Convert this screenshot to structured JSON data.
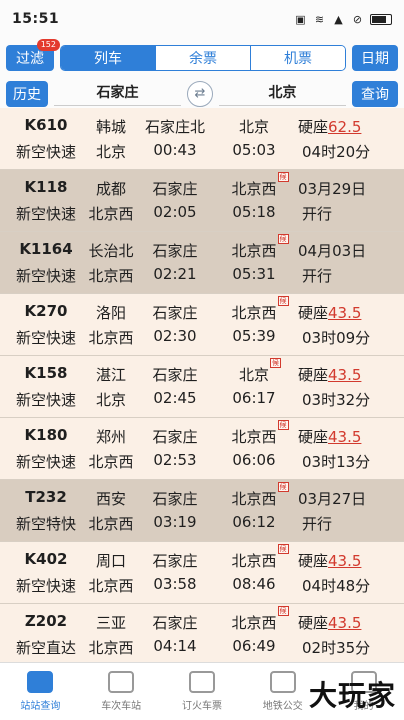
{
  "status_bar": {
    "time": "15:51"
  },
  "top": {
    "filter_label": "过滤",
    "filter_badge": "152",
    "tabs": [
      {
        "label": "列车",
        "active": true
      },
      {
        "label": "余票",
        "active": false
      },
      {
        "label": "机票",
        "active": false
      }
    ],
    "date_label": "日期"
  },
  "search": {
    "history_label": "历史",
    "from": "石家庄",
    "to": "北京",
    "swap_icon": "swap-icon",
    "query_label": "查询"
  },
  "trains": [
    {
      "code": "K610",
      "type": "新空快速",
      "origin": "韩城",
      "dest": "北京",
      "from": "石家庄北",
      "to": "北京",
      "to_fu": false,
      "dep": "00:43",
      "arr": "05:03",
      "seat": "硬座",
      "price": "62.5",
      "duration": "04时20分",
      "status": "",
      "shade": "light"
    },
    {
      "code": "K118",
      "type": "新空快速",
      "origin": "成都",
      "dest": "北京西",
      "from": "石家庄",
      "to": "北京西",
      "to_fu": true,
      "dep": "02:05",
      "arr": "05:18",
      "seat": "",
      "price": "",
      "duration": "",
      "status_date": "03月29日",
      "status": "开行",
      "shade": "dark"
    },
    {
      "code": "K1164",
      "type": "新空快速",
      "origin": "长治北",
      "dest": "北京西",
      "from": "石家庄",
      "to": "北京西",
      "to_fu": true,
      "dep": "02:21",
      "arr": "05:31",
      "seat": "",
      "price": "",
      "duration": "",
      "status_date": "04月03日",
      "status": "开行",
      "shade": "dark"
    },
    {
      "code": "K270",
      "type": "新空快速",
      "origin": "洛阳",
      "dest": "北京西",
      "from": "石家庄",
      "to": "北京西",
      "to_fu": true,
      "dep": "02:30",
      "arr": "05:39",
      "seat": "硬座",
      "price": "43.5",
      "duration": "03时09分",
      "status": "",
      "shade": "light"
    },
    {
      "code": "K158",
      "type": "新空快速",
      "origin": "湛江",
      "dest": "北京",
      "from": "石家庄",
      "to": "北京",
      "to_fu": true,
      "dep": "02:45",
      "arr": "06:17",
      "seat": "硬座",
      "price": "43.5",
      "duration": "03时32分",
      "status": "",
      "shade": "light"
    },
    {
      "code": "K180",
      "type": "新空快速",
      "origin": "郑州",
      "dest": "北京西",
      "from": "石家庄",
      "to": "北京西",
      "to_fu": true,
      "dep": "02:53",
      "arr": "06:06",
      "seat": "硬座",
      "price": "43.5",
      "duration": "03时13分",
      "status": "",
      "shade": "light"
    },
    {
      "code": "T232",
      "type": "新空特快",
      "origin": "西安",
      "dest": "北京西",
      "from": "石家庄",
      "to": "北京西",
      "to_fu": true,
      "dep": "03:19",
      "arr": "06:12",
      "seat": "",
      "price": "",
      "duration": "",
      "status_date": "03月27日",
      "status": "开行",
      "shade": "dark"
    },
    {
      "code": "K402",
      "type": "新空快速",
      "origin": "周口",
      "dest": "北京西",
      "from": "石家庄",
      "to": "北京西",
      "to_fu": true,
      "dep": "03:58",
      "arr": "08:46",
      "seat": "硬座",
      "price": "43.5",
      "duration": "04时48分",
      "status": "",
      "shade": "light"
    },
    {
      "code": "Z202",
      "type": "新空直达",
      "origin": "三亚",
      "dest": "北京西",
      "from": "石家庄",
      "to": "北京西",
      "to_fu": true,
      "dep": "04:14",
      "arr": "06:49",
      "seat": "硬座",
      "price": "43.5",
      "duration": "02时35分",
      "status": "",
      "shade": "light"
    }
  ],
  "fu_tag": "候",
  "bottom_nav": [
    {
      "label": "站站查询",
      "icon": "train-icon",
      "active": true
    },
    {
      "label": "车次车站",
      "icon": "briefcase-icon",
      "active": false
    },
    {
      "label": "订火车票",
      "icon": "ticket-icon",
      "active": false
    },
    {
      "label": "地铁公交",
      "icon": "subway-icon",
      "active": false
    },
    {
      "label": "我的",
      "icon": "user-icon",
      "active": false
    }
  ],
  "watermark": "大玩家"
}
